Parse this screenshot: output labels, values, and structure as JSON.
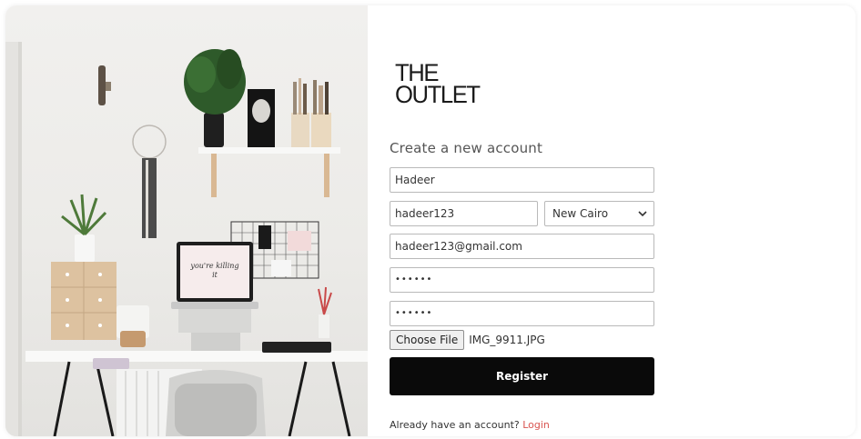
{
  "brand": {
    "line1": "THE",
    "line2": "OUTLET"
  },
  "form": {
    "heading": "Create a new account",
    "first_name_value": "Hadeer",
    "username_value": "hadeer123",
    "city_selected": "New Cairo",
    "email_value": "hadeer123@gmail.com",
    "password_masked": "••••••",
    "confirm_password_masked": "••••••",
    "file_button_label": "Choose File",
    "file_name": "IMG_9911.JPG",
    "register_label": "Register"
  },
  "footer": {
    "prompt": "Already have an account?",
    "login_link": "Login"
  },
  "photo": {
    "laptop_screen_text": "you're killing it"
  },
  "colors": {
    "button_bg": "#0a0a0a",
    "link": "#d9534f",
    "border": "#b9b9b9"
  },
  "icons": {
    "select_arrow": "chevron-down-icon"
  }
}
